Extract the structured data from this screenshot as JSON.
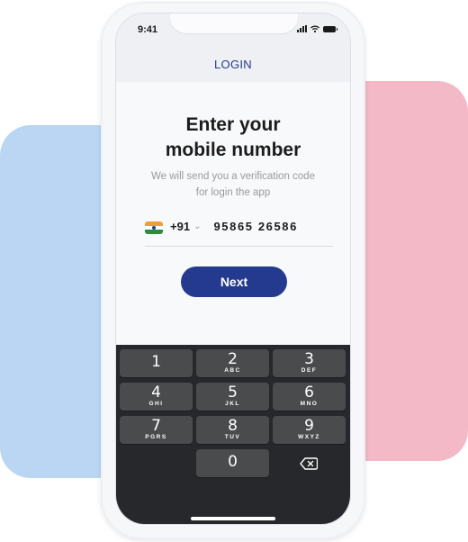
{
  "status_bar": {
    "time": "9:41",
    "icons": [
      "signal-icon",
      "wifi-icon",
      "battery-icon"
    ]
  },
  "header": {
    "title": "LOGIN"
  },
  "main": {
    "heading_line1": "Enter your",
    "heading_line2": "mobile number",
    "subtext_line1": "We will send you a verification code",
    "subtext_line2": "for login the app",
    "country": {
      "flag": "india-flag-icon",
      "code": "+91",
      "dropdown_icon": "chevron-down-icon"
    },
    "phone_number": "95865 26586",
    "next_button": "Next"
  },
  "keypad": {
    "keys": [
      {
        "digit": "1",
        "letters": ""
      },
      {
        "digit": "2",
        "letters": "ABC"
      },
      {
        "digit": "3",
        "letters": "DEF"
      },
      {
        "digit": "4",
        "letters": "GHI"
      },
      {
        "digit": "5",
        "letters": "JKL"
      },
      {
        "digit": "6",
        "letters": "MNO"
      },
      {
        "digit": "7",
        "letters": "PGRS"
      },
      {
        "digit": "8",
        "letters": "TUV"
      },
      {
        "digit": "9",
        "letters": "WXYZ"
      },
      {
        "digit": "0",
        "letters": ""
      }
    ],
    "backspace_icon": "backspace-icon"
  },
  "colors": {
    "accent": "#243a8e",
    "title_text": "#223a8c",
    "background_blue": "#bad6f3",
    "background_pink": "#f3b9c6",
    "keyboard_bg": "#26282b",
    "key_bg": "#4a4b4d"
  }
}
